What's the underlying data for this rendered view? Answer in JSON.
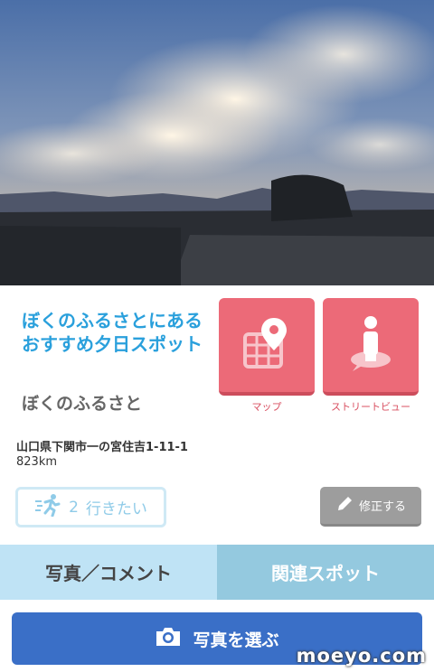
{
  "spot": {
    "title": "ぼくのふるさとにあるおすすめ夕日スポット",
    "subtitle": "ぼくのふるさと",
    "address": "山口県下関市一の宮住吉1-11-1",
    "distance": "823km"
  },
  "actions": {
    "map_label": "マップ",
    "streetview_label": "ストリートビュー"
  },
  "want": {
    "count": "2",
    "label": "行きたい"
  },
  "edit": {
    "label": "修正する"
  },
  "tabs": [
    {
      "label": "写真／コメント"
    },
    {
      "label": "関連スポット"
    }
  ],
  "photo_button": {
    "label": "写真を選ぶ"
  },
  "watermark": "moeyo.com",
  "colors": {
    "title": "#2aa0dc",
    "action": "#ec6a78",
    "tab_active": "#bfe3f5",
    "tab_inactive": "#94c9df",
    "photo_button": "#3a6fc7"
  }
}
